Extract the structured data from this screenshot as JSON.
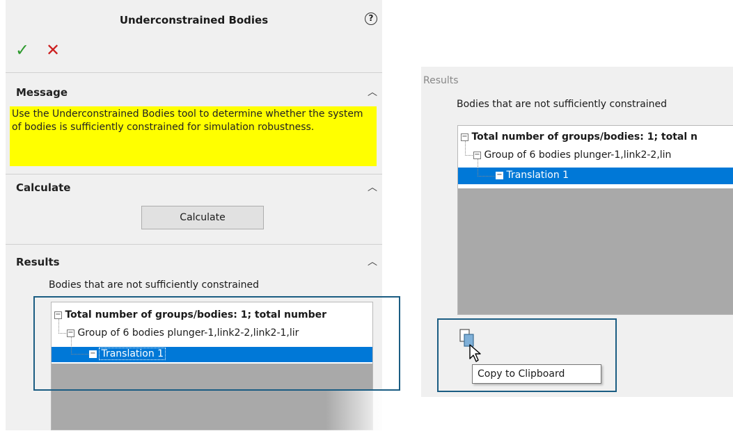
{
  "panel": {
    "title": "Underconstrained Bodies",
    "help_icon": "?",
    "ok_icon": "✓",
    "cancel_icon": "✕"
  },
  "sections": {
    "message": {
      "title": "Message",
      "text": "Use the Underconstrained Bodies tool to determine whether the system of bodies is sufficiently constrained for simulation robustness."
    },
    "calculate": {
      "title": "Calculate",
      "button_label": "Calculate"
    },
    "results": {
      "title": "Results",
      "caption": "Bodies that are not sufficiently constrained",
      "tree": {
        "root": "Total number of groups/bodies: 1; total number",
        "group": "Group of 6 bodies plunger-1,link2-2,link2-1,lir",
        "leaf": "Translation 1"
      }
    }
  },
  "zoom": {
    "results_title": "Results",
    "caption": "Bodies that are not sufficiently constrained",
    "tree": {
      "root": "Total number of groups/bodies: 1; total n",
      "group": "Group of 6 bodies plunger-1,link2-2,lin",
      "leaf": "Translation 1"
    },
    "tooltip": "Copy to Clipboard"
  },
  "colors": {
    "message_bg": "#ffff00",
    "selection": "#0078d7",
    "callout": "#1a5c82",
    "ok": "#2d9a2d",
    "cancel": "#cc1f1f"
  }
}
